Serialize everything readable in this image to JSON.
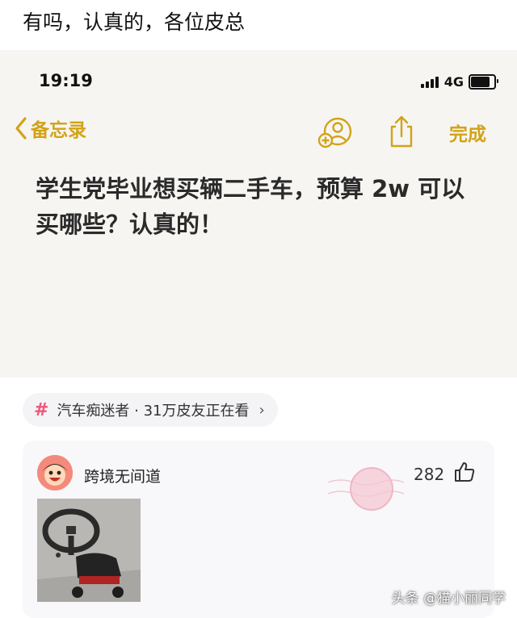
{
  "caption": "有吗，认真的，各位皮总",
  "screenshot": {
    "status_bar": {
      "time": "19:19",
      "network": "4G"
    },
    "nav": {
      "back_label": "备忘录",
      "done_label": "完成"
    },
    "note_text": "学生党毕业想买辆二手车，预算 2w 可以买哪些？认真的！",
    "accent_color": "#d3a316"
  },
  "topic": {
    "label": "汽车痴迷者 · 31万皮友正在看",
    "hash_color": "#f0567a"
  },
  "comment": {
    "username": "跨境无间道",
    "likes": "282"
  },
  "watermark": "头条 @猫小丽同学"
}
